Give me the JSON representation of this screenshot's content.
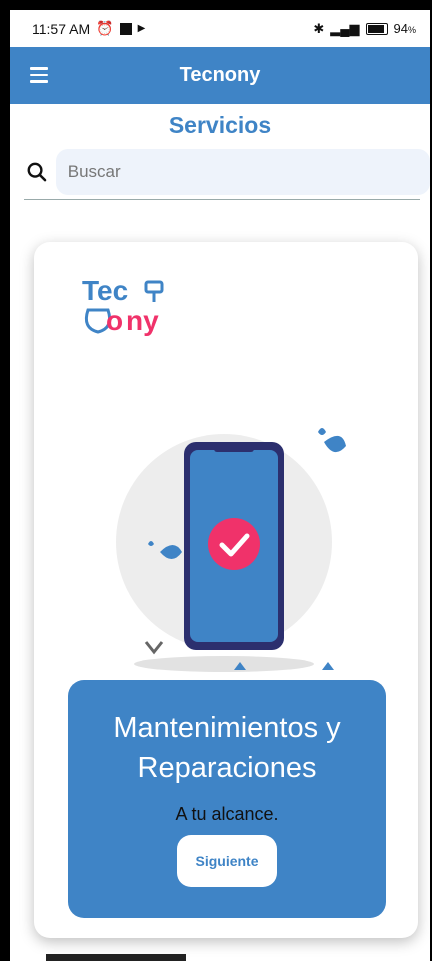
{
  "status": {
    "time": "11:57 AM",
    "battery": "94",
    "battery_suffix": "%"
  },
  "appbar": {
    "title": "Tecnony"
  },
  "page": {
    "title": "Servicios"
  },
  "search": {
    "placeholder": "Buscar"
  },
  "card": {
    "logo_top": "Tec",
    "logo_bottom": "ny",
    "heading": "Mantenimientos y Reparaciones",
    "tagline": "A tu alcance.",
    "button_label": "Siguiente"
  },
  "colors": {
    "primary": "#3f84c6",
    "accent_pink": "#f0326a",
    "phone_dark": "#2c2f6e"
  }
}
